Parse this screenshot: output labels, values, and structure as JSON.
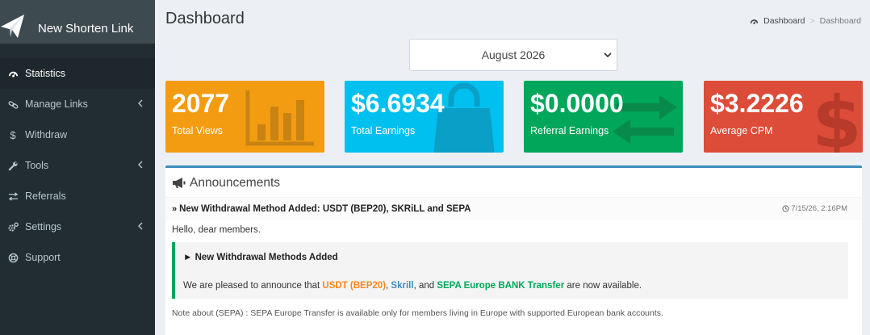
{
  "brand": {
    "name": "New Shorten Link"
  },
  "sidebar": {
    "items": [
      {
        "label": "Statistics",
        "icon": "dashboard-icon",
        "active": true,
        "has_chevron": false
      },
      {
        "label": "Manage Links",
        "icon": "link-icon",
        "active": false,
        "has_chevron": true
      },
      {
        "label": "Withdraw",
        "icon": "dollar-icon",
        "active": false,
        "has_chevron": false
      },
      {
        "label": "Tools",
        "icon": "wrench-icon",
        "active": false,
        "has_chevron": true
      },
      {
        "label": "Referrals",
        "icon": "exchange-icon",
        "active": false,
        "has_chevron": false
      },
      {
        "label": "Settings",
        "icon": "cogs-icon",
        "active": false,
        "has_chevron": true
      },
      {
        "label": "Support",
        "icon": "lifebuoy-icon",
        "active": false,
        "has_chevron": false
      }
    ]
  },
  "header": {
    "title": "Dashboard",
    "breadcrumb": {
      "home": "Dashboard",
      "separator": ">",
      "current": "Dashboard"
    }
  },
  "month_select": {
    "value": "August 2026"
  },
  "stats": [
    {
      "value": "2077",
      "label": "Total Views",
      "icon": "bar-chart-icon",
      "color": "#f39c12"
    },
    {
      "value": "$6.6934",
      "label": "Total Earnings",
      "icon": "shopping-bag-icon",
      "color": "#00c0ef"
    },
    {
      "value": "$0.0000",
      "label": "Referral Earnings",
      "icon": "exchange-icon",
      "color": "#00a65a"
    },
    {
      "value": "$3.2226",
      "label": "Average CPM",
      "icon": "dollar-icon",
      "color": "#dd4b39"
    }
  ],
  "announcements": {
    "title": "Announcements",
    "item": {
      "title": "New Withdrawal Method Added: USDT (BEP20), SKRiLL and SEPA",
      "time": "7/15/26, 2:16PM",
      "greeting": "Hello, dear members.",
      "callout_title": "► New Withdrawal Methods Added",
      "callout_text_prefix": "We are pleased to announce that ",
      "highlight_usdt": "USDT (BEP20)",
      "sep1": ", ",
      "highlight_skrill": "Skrill",
      "sep2": ", and ",
      "highlight_sepa": "SEPA Europe BANK Transfer",
      "callout_text_suffix": " are now available.",
      "note": "Note about (SEPA) : SEPA Europe Transfer is available only for members living in Europe with supported European bank accounts."
    }
  },
  "colors": {
    "sidebar_bg": "#222d32",
    "brand_bg": "#3d4a50",
    "accent_blue": "#3c8dbc",
    "callout_border": "#00a65a",
    "highlight_orange": "#ff851b",
    "highlight_blue": "#3c8dbc",
    "highlight_green": "#00a65a"
  }
}
